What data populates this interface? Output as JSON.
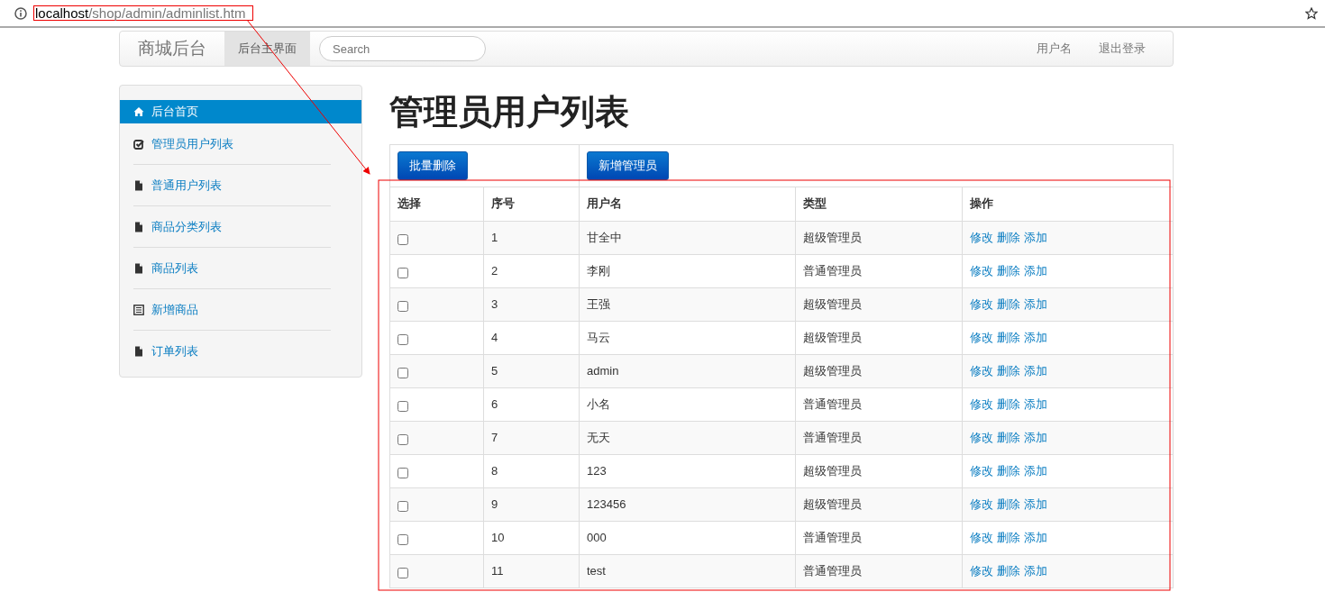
{
  "address_bar": {
    "host": "localhost",
    "path": "/shop/admin/adminlist.htm"
  },
  "navbar": {
    "brand": "商城后台",
    "items": [
      {
        "label": "后台主界面",
        "selected": true
      }
    ],
    "search": {
      "placeholder": "Search"
    },
    "right_links": [
      "用户名",
      "退出登录"
    ]
  },
  "sidebar": {
    "items": [
      {
        "label": "后台首页",
        "kind": "home",
        "selected": true
      },
      {
        "label": "管理员用户列表",
        "kind": "check",
        "selected": false
      },
      {
        "label": "普通用户列表",
        "kind": "file",
        "selected": false
      },
      {
        "label": "商品分类列表",
        "kind": "file",
        "selected": false
      },
      {
        "label": "商品列表",
        "kind": "file",
        "selected": false
      },
      {
        "label": "新增商品",
        "kind": "list",
        "selected": false
      },
      {
        "label": "订单列表",
        "kind": "file",
        "selected": false
      }
    ]
  },
  "page_title": "管理员用户列表",
  "toolbar": {
    "buttons": [
      "批量删除",
      "新增管理员"
    ]
  },
  "table": {
    "columns": [
      "选择",
      "序号",
      "用户名",
      "类型",
      "操作"
    ],
    "rows": [
      {
        "checked": false,
        "no": "1",
        "username": "甘全中",
        "type": "超级管理员",
        "actions": [
          "修改",
          "删除",
          "添加"
        ]
      },
      {
        "checked": false,
        "no": "2",
        "username": "李刚",
        "type": "普通管理员",
        "actions": [
          "修改",
          "删除",
          "添加"
        ]
      },
      {
        "checked": false,
        "no": "3",
        "username": "王强",
        "type": "超级管理员",
        "actions": [
          "修改",
          "删除",
          "添加"
        ]
      },
      {
        "checked": false,
        "no": "4",
        "username": "马云",
        "type": "超级管理员",
        "actions": [
          "修改",
          "删除",
          "添加"
        ]
      },
      {
        "checked": false,
        "no": "5",
        "username": "admin",
        "type": "超级管理员",
        "actions": [
          "修改",
          "删除",
          "添加"
        ]
      },
      {
        "checked": false,
        "no": "6",
        "username": "小名",
        "type": "普通管理员",
        "actions": [
          "修改",
          "删除",
          "添加"
        ]
      },
      {
        "checked": false,
        "no": "7",
        "username": "无天",
        "type": "普通管理员",
        "actions": [
          "修改",
          "删除",
          "添加"
        ]
      },
      {
        "checked": false,
        "no": "8",
        "username": "123",
        "type": "超级管理员",
        "actions": [
          "修改",
          "删除",
          "添加"
        ]
      },
      {
        "checked": false,
        "no": "9",
        "username": "123456",
        "type": "超级管理员",
        "actions": [
          "修改",
          "删除",
          "添加"
        ]
      },
      {
        "checked": false,
        "no": "10",
        "username": "000",
        "type": "普通管理员",
        "actions": [
          "修改",
          "删除",
          "添加"
        ]
      },
      {
        "checked": false,
        "no": "11",
        "username": "test",
        "type": "普通管理员",
        "actions": [
          "修改",
          "删除",
          "添加"
        ]
      }
    ]
  }
}
